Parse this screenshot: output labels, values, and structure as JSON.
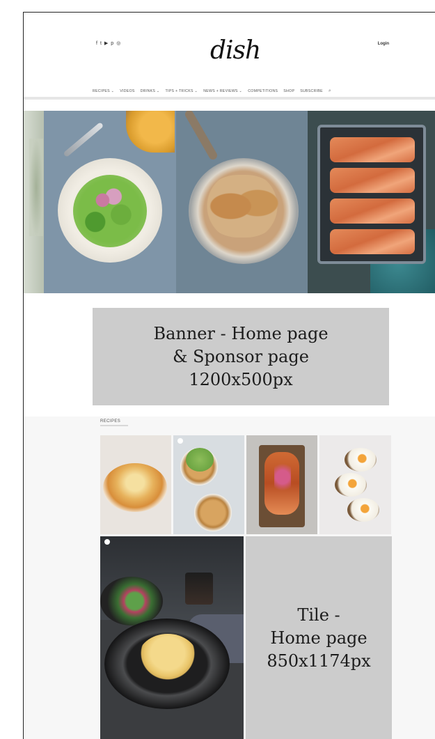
{
  "header": {
    "social_icons": [
      "facebook-icon",
      "twitter-icon",
      "youtube-icon",
      "pinterest-icon",
      "instagram-icon"
    ],
    "social_glyphs": [
      "f",
      "t",
      "▶",
      "p",
      "◎"
    ],
    "logo": "dish",
    "login": "Login"
  },
  "nav": {
    "items": [
      "RECIPES",
      "VIDEOS",
      "DRINKS",
      "TIPS + TRICKS",
      "NEWS + REVIEWS",
      "COMPETITIONS",
      "SHOP",
      "SUBSCRIBE"
    ],
    "chevrons": [
      "⌄",
      "",
      "⌄",
      "⌄",
      "⌄",
      "",
      "",
      ""
    ],
    "search_icon": "search-icon"
  },
  "banner": {
    "line1": "Banner - Home page",
    "line2": "& Sponsor page",
    "line3": "1200x500px"
  },
  "recipes": {
    "label": "RECIPES"
  },
  "tile": {
    "line1": "Tile -",
    "line2": "Home page",
    "line3": "850x1174px"
  },
  "colors": {
    "placeholder_gray": "#cccccc",
    "frame_border": "#222222"
  }
}
